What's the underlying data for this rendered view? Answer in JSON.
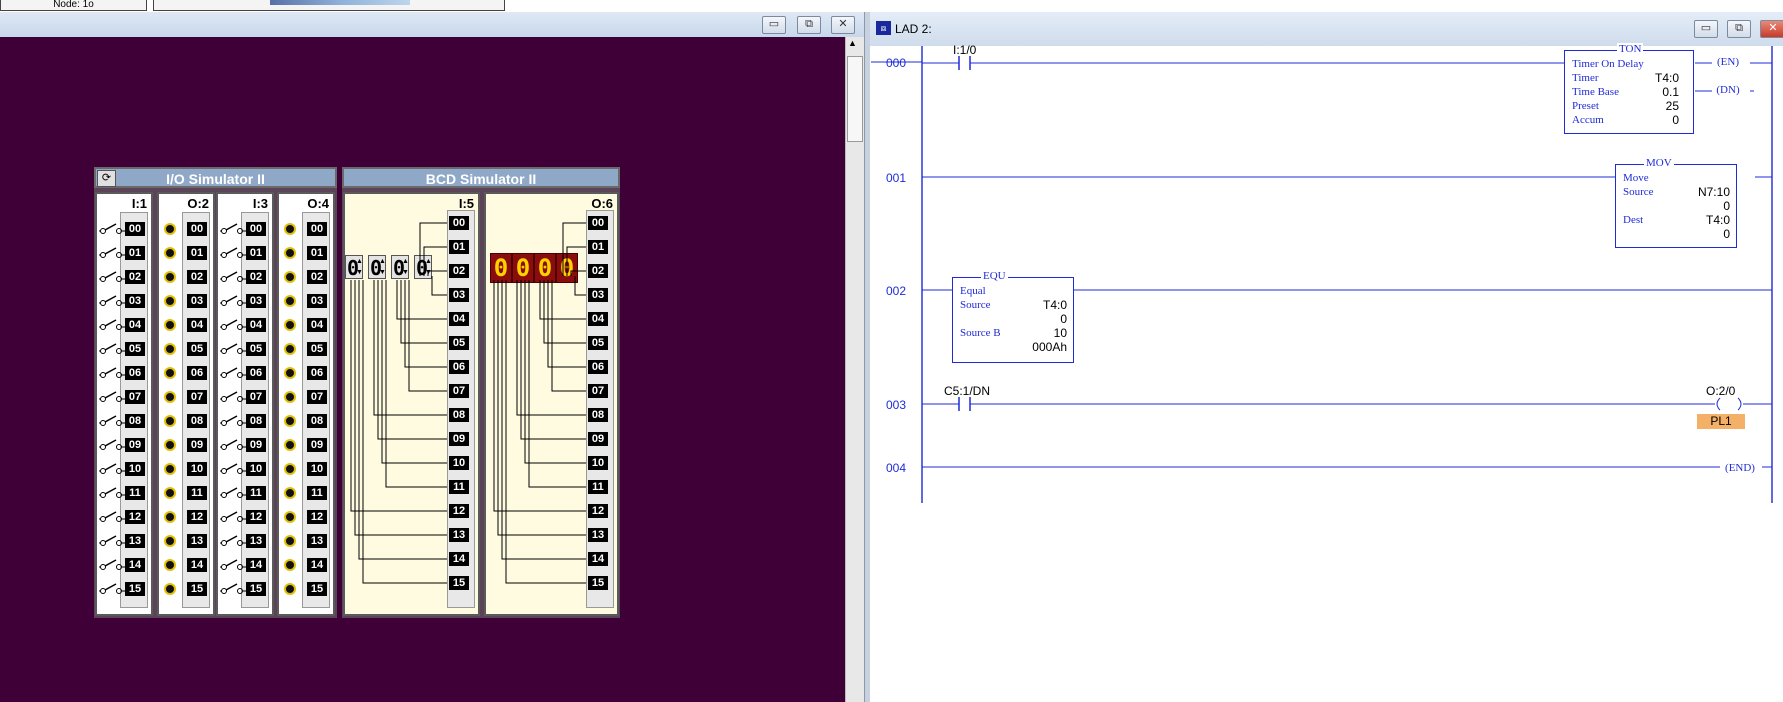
{
  "top": {
    "node_label": "Node: 1o"
  },
  "left_window": {
    "buttons": {
      "min": "▭",
      "restore": "⧉",
      "close": "✕"
    }
  },
  "io_sim": {
    "title": "I/O Simulator II",
    "refresh_icon": "refresh-icon",
    "columns": [
      "I:1",
      "O:2",
      "I:3",
      "O:4"
    ]
  },
  "bcd_sim": {
    "title": "BCD Simulator II",
    "input_header": "I:5",
    "output_header": "O:6",
    "thumbwheel_digits": [
      "0",
      "0",
      "0",
      "0"
    ],
    "led_digits": [
      "0",
      "0",
      "0",
      "0"
    ]
  },
  "bits": [
    "00",
    "01",
    "02",
    "03",
    "04",
    "05",
    "06",
    "07",
    "08",
    "09",
    "10",
    "11",
    "12",
    "13",
    "14",
    "15"
  ],
  "lad": {
    "title": "LAD 2:",
    "buttons": {
      "min": "▭",
      "restore": "⧉",
      "close": "✕"
    },
    "rungs": [
      "000",
      "001",
      "002",
      "003",
      "004"
    ],
    "r0": {
      "contact_addr": "I:1/0",
      "ton": {
        "name": "TON",
        "desc": "Timer On Delay",
        "timer_label": "Timer",
        "timer": "T4:0",
        "base_label": "Time Base",
        "base": "0.1",
        "preset_label": "Preset",
        "preset": "25",
        "accum_label": "Accum",
        "accum": "0"
      },
      "en": "EN",
      "dn": "DN"
    },
    "r1": {
      "mov": {
        "name": "MOV",
        "desc": "Move",
        "source_label": "Source",
        "source": "N7:10",
        "source_val": "0",
        "dest_label": "Dest",
        "dest": "T4:0",
        "dest_val": "0"
      }
    },
    "r2": {
      "equ": {
        "name": "EQU",
        "desc": "Equal",
        "a_label": "Source",
        "a": "T4:0",
        "a_val": "0",
        "b_label": "Source B",
        "b": "10",
        "b_val": "000Ah"
      }
    },
    "r3": {
      "contact_addr": "C5:1/DN",
      "coil_addr": "O:2/0",
      "coil_label": "PL1"
    },
    "r4": {
      "end": "END"
    }
  }
}
